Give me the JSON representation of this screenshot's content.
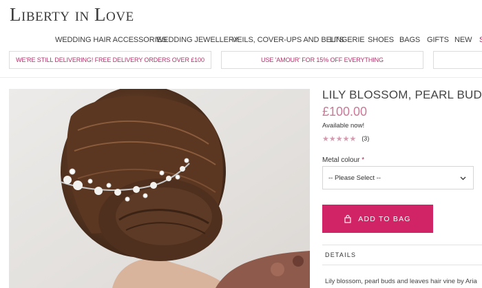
{
  "brand": {
    "logo_text": "Liberty in Love"
  },
  "nav": {
    "items": [
      {
        "label": "WEDDING HAIR ACCESSORIES"
      },
      {
        "label": "WEDDING JEWELLERY"
      },
      {
        "label": "VEILS, COVER-UPS AND BELTS"
      },
      {
        "label": "LINGERIE"
      },
      {
        "label": "SHOES"
      },
      {
        "label": "BAGS"
      },
      {
        "label": "GIFTS"
      },
      {
        "label": "NEW"
      },
      {
        "label": "S"
      }
    ]
  },
  "promos": [
    {
      "text": "WE'RE STILL DELIVERING! FREE DELIVERY ORDERS OVER £100"
    },
    {
      "text": "USE 'AMOUR' FOR 15% OFF EVERYTHING"
    },
    {
      "text": ""
    }
  ],
  "product": {
    "title": "LILY BLOSSOM, PEARL BUDS A",
    "price": "£100.00",
    "availability": "Available now!",
    "rating": {
      "stars": 5,
      "stars_text": "★★★★★",
      "count": "(3)"
    },
    "option": {
      "label": "Metal colour",
      "required_mark": "*",
      "selected": "-- Please Select --"
    },
    "add_to_bag": "ADD TO BAG",
    "details_heading": "DETAILS",
    "description": "Lily blossom, pearl buds and leaves hair vine by Aria"
  },
  "colors": {
    "accent": "#d12466",
    "price": "#c87a98",
    "promo_text": "#b0356a"
  }
}
